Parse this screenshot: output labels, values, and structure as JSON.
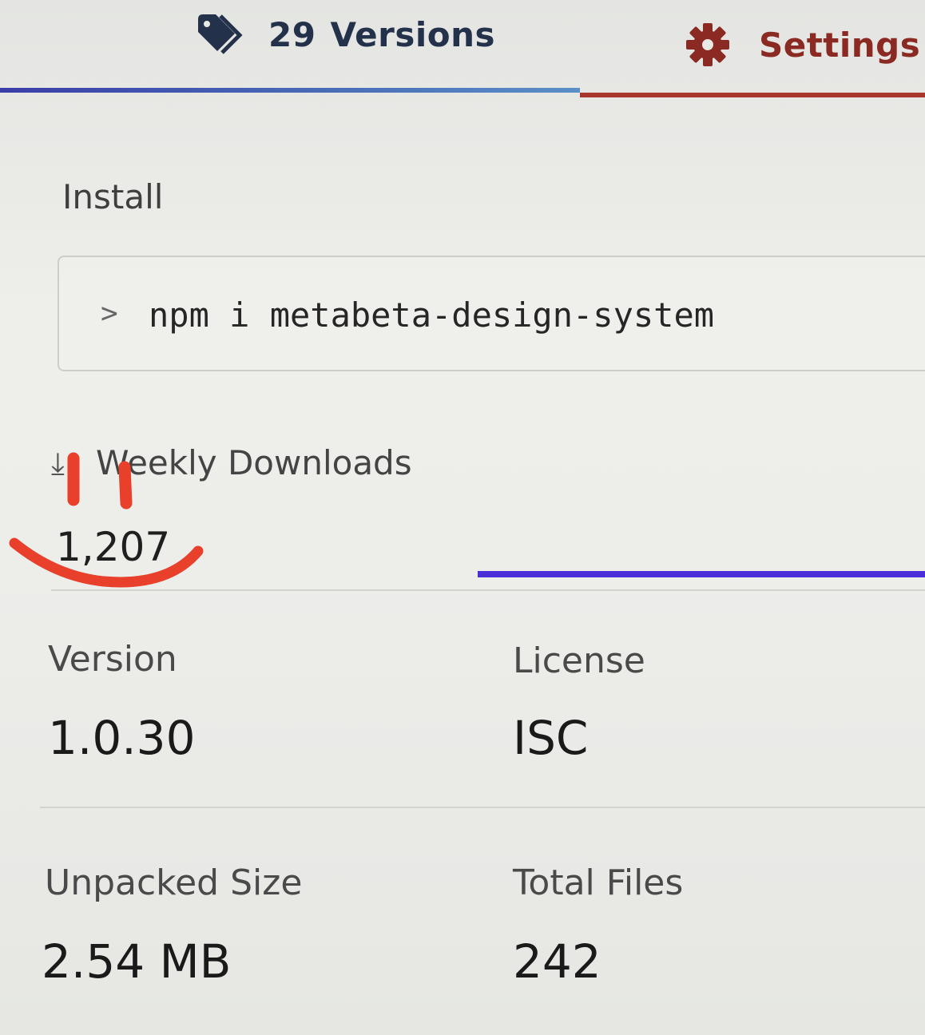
{
  "tabs": {
    "versions": {
      "count": "29",
      "label": "Versions",
      "icon": "tag-icon",
      "color": "#23324a"
    },
    "settings": {
      "label": "Settings",
      "icon": "gear-icon",
      "color": "#8a2a22"
    }
  },
  "install": {
    "label": "Install",
    "prompt": ">",
    "command": "npm i metabeta-design-system"
  },
  "downloads": {
    "icon": "download-icon",
    "label": "Weekly Downloads",
    "value": "1,207"
  },
  "meta": {
    "version": {
      "label": "Version",
      "value": "1.0.30"
    },
    "license": {
      "label": "License",
      "value": "ISC"
    },
    "unpacked_size": {
      "label": "Unpacked Size",
      "value": "2.54 MB"
    },
    "total_files": {
      "label": "Total Files",
      "value": "242"
    }
  },
  "colors": {
    "accent_versions": "#3a3ea8",
    "accent_settings": "#a8362c",
    "sparkline": "#4b2ed8",
    "annotation": "#e8402a"
  }
}
